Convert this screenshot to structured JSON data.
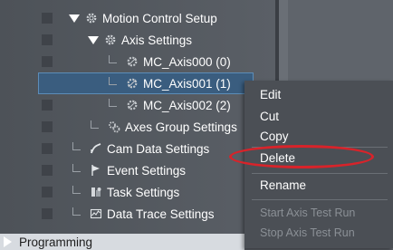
{
  "tree": {
    "motion_control_setup": "Motion Control Setup",
    "axis_settings": "Axis Settings",
    "axis0": "MC_Axis000 (0)",
    "axis1": "MC_Axis001 (1)",
    "axis2": "MC_Axis002 (2)",
    "axes_group_settings": "Axes Group Settings",
    "cam_data_settings": "Cam Data Settings",
    "event_settings": "Event Settings",
    "task_settings": "Task Settings",
    "data_trace_settings": "Data Trace Settings",
    "programming": "Programming"
  },
  "context_menu": {
    "edit": "Edit",
    "cut": "Cut",
    "copy": "Copy",
    "delete": "Delete",
    "rename": "Rename",
    "start_axis_test_run": "Start Axis Test Run",
    "stop_axis_test_run": "Stop Axis Test Run"
  },
  "colors": {
    "highlight_ring": "#d8232a",
    "selection": "#3a5d7f",
    "disabled_text": "#8b9096"
  }
}
